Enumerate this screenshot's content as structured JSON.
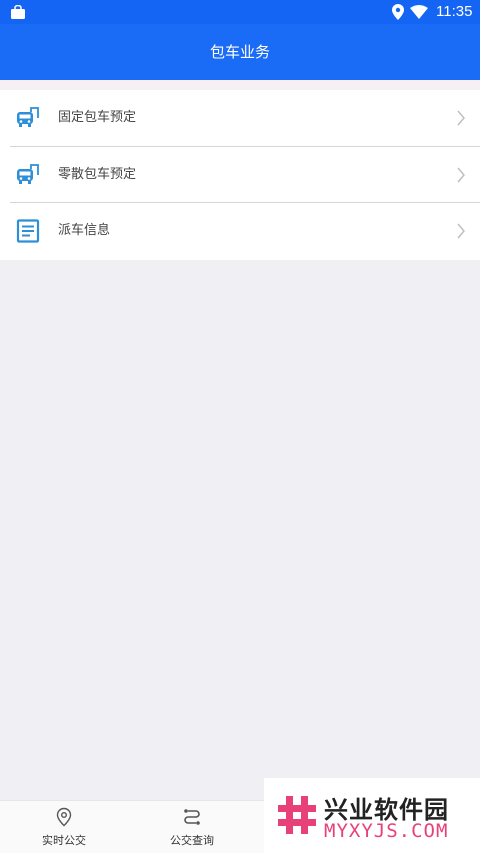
{
  "status_bar": {
    "time": "11:35"
  },
  "app_bar": {
    "title": "包车业务"
  },
  "menu": {
    "items": [
      {
        "label": "固定包车预定",
        "icon": "bus-icon"
      },
      {
        "label": "零散包车预定",
        "icon": "bus-icon"
      },
      {
        "label": "派车信息",
        "icon": "document-icon"
      }
    ]
  },
  "tab_bar": {
    "tabs": [
      {
        "label": "实时公交",
        "icon": "location-pin-icon"
      },
      {
        "label": "公交查询",
        "icon": "route-icon"
      }
    ]
  },
  "watermark": {
    "name": "兴业软件园",
    "site": "MYXYJS.COM"
  },
  "colors": {
    "accent": "#1a6cf7",
    "icon_blue": "#2d8fd6",
    "watermark_pink": "#e8417a"
  }
}
